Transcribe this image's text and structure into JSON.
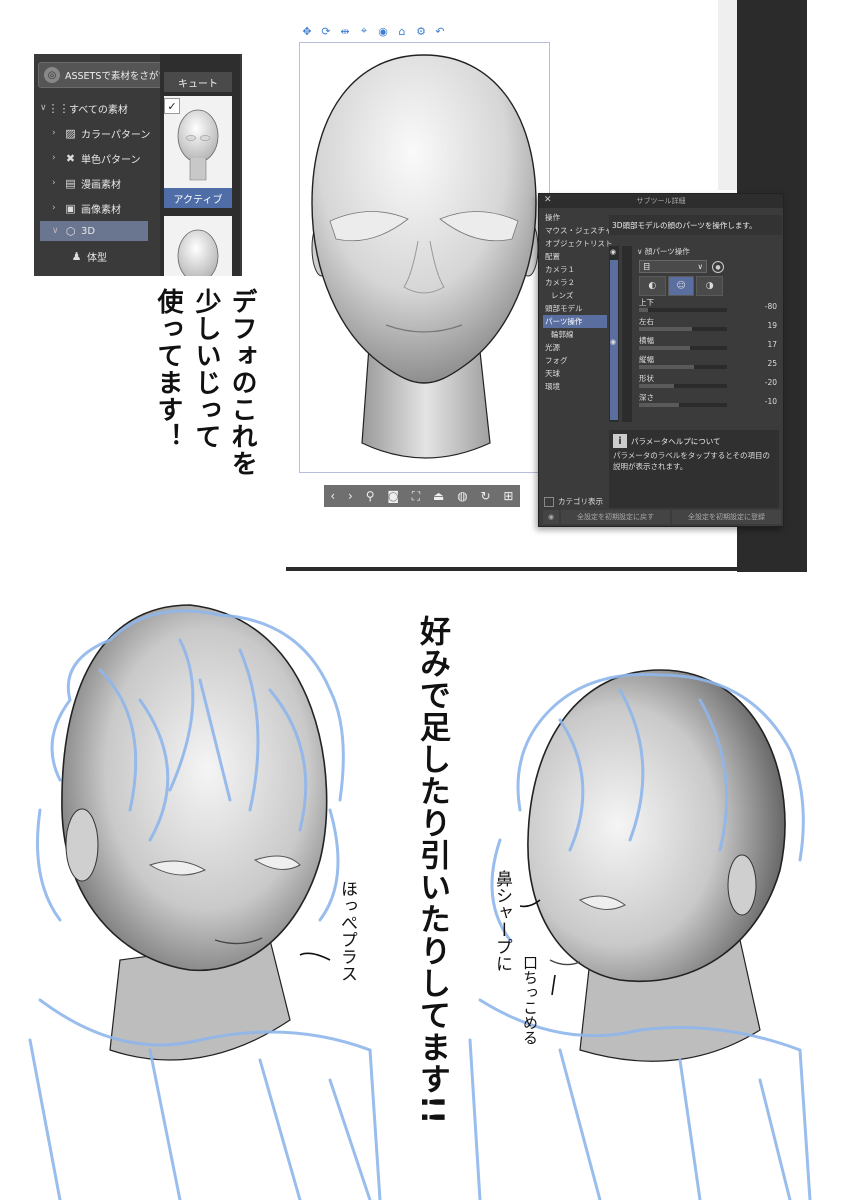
{
  "assets_panel": {
    "search_button": "ASSETSで素材をさがす",
    "tree": [
      {
        "label": "すべての素材",
        "icon": "grid-icon",
        "expanded": true
      },
      {
        "label": "カラーパターン",
        "icon": "pattern-icon"
      },
      {
        "label": "単色パターン",
        "icon": "cross-pattern-icon"
      },
      {
        "label": "漫画素材",
        "icon": "manga-icon"
      },
      {
        "label": "画像素材",
        "icon": "image-icon"
      },
      {
        "label": "3D",
        "icon": "cube-icon",
        "selected": true,
        "expanded": true
      },
      {
        "label": "体型",
        "icon": "body-icon"
      }
    ],
    "thumb_tab": "キュート",
    "thumb_active_label": "アクティブ"
  },
  "notes": {
    "left_col1": "デフォのこれを",
    "left_col2": "少しいじって",
    "left_col3": "使ってます！",
    "center": "好みで足したり引いたりしてます!!",
    "scribble1": "ほっぺプラス",
    "scribble2": "鼻シャープに",
    "scribble3": "口ちっこめる"
  },
  "viewport_toolbar_icons": [
    "move-icon",
    "rotate-icon",
    "pan-icon",
    "target-icon",
    "camera-icon",
    "ground-icon",
    "settings-icon",
    "undo-icon"
  ],
  "camera_bar_icons": [
    "prev-icon",
    "next-icon",
    "wrench-icon",
    "camera-icon",
    "frame-icon",
    "ground-icon",
    "object-icon",
    "reset-icon",
    "register-icon"
  ],
  "subtool": {
    "title": "サブツール詳細",
    "categories": [
      {
        "label": "操作"
      },
      {
        "label": "マウス・ジェスチャー"
      },
      {
        "label": "オブジェクトリスト"
      },
      {
        "label": "配置"
      },
      {
        "label": "カメラ１"
      },
      {
        "label": "カメラ２"
      },
      {
        "label": "レンズ",
        "indent": true
      },
      {
        "label": "頭部モデル"
      },
      {
        "label": "パーツ操作",
        "selected": true
      },
      {
        "label": "輪郭線",
        "indent": true
      },
      {
        "label": "光源"
      },
      {
        "label": "フォグ"
      },
      {
        "label": "天球"
      },
      {
        "label": "環境"
      }
    ],
    "description": "3D頭部モデルの顔のパーツを操作します。",
    "group_label": "顔パーツ操作",
    "part_select": "目",
    "params": [
      {
        "label": "上下",
        "value": "-80",
        "fill": 0.1
      },
      {
        "label": "左右",
        "value": "19",
        "fill": 0.6
      },
      {
        "label": "横幅",
        "value": "17",
        "fill": 0.58
      },
      {
        "label": "縦幅",
        "value": "25",
        "fill": 0.62
      },
      {
        "label": "形状",
        "value": "-20",
        "fill": 0.4
      },
      {
        "label": "深さ",
        "value": "-10",
        "fill": 0.45
      }
    ],
    "help_title": "パラメータヘルプについて",
    "help_body": "パラメータのラベルをタップするとその項目の説明が表示されます。",
    "category_display": "カテゴリ表示",
    "reset_button": "全設定を初期設定に戻す",
    "register_button": "全設定を初期設定に登録"
  },
  "colors": {
    "panel_dark": "#3a3a3a",
    "accent_blue": "#5a6fa0",
    "sketch_blue": "#8fb6ec"
  }
}
